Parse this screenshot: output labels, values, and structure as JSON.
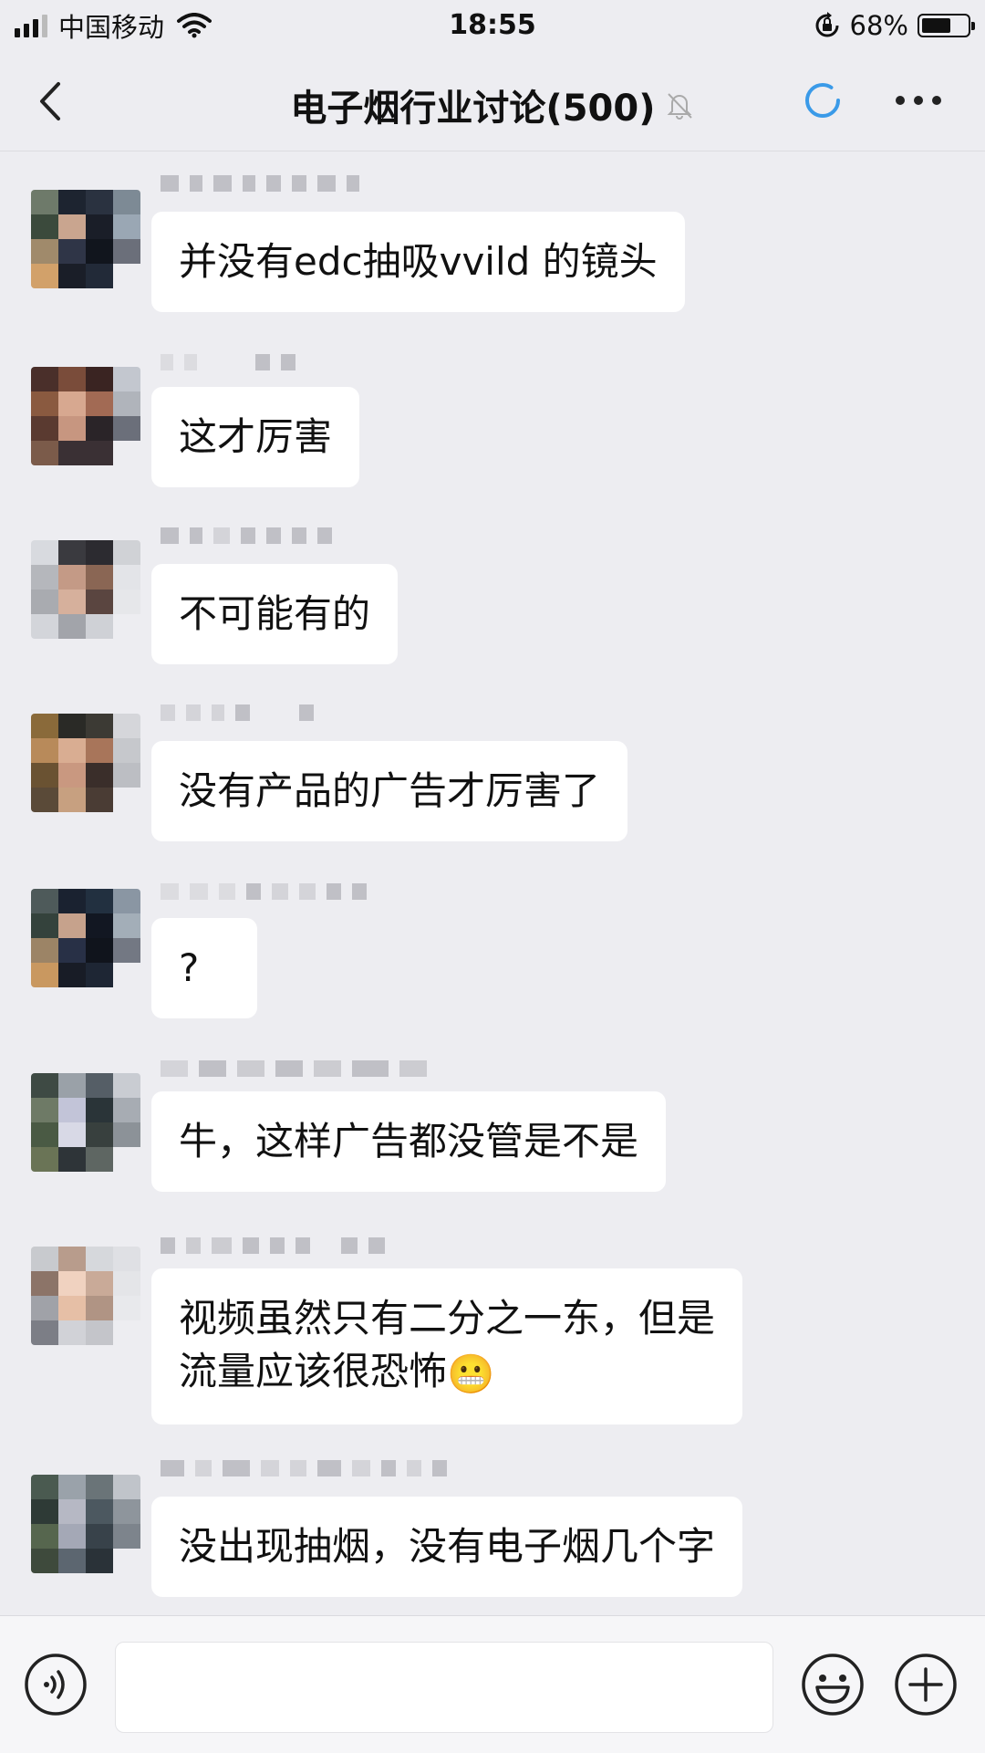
{
  "status_bar": {
    "carrier": "中国移动",
    "time": "18:55",
    "battery_percent": "68%",
    "battery_level": 0.68,
    "icons": [
      "signal-icon",
      "wifi-icon",
      "rotation-lock-icon",
      "battery-icon"
    ]
  },
  "nav": {
    "title": "电子烟行业讨论(500)",
    "icons": [
      "back-icon",
      "mute-bell-icon",
      "loading-spinner-icon",
      "more-icon"
    ]
  },
  "messages": [
    {
      "text": "并没有edc抽吸vvild 的镜头"
    },
    {
      "text": "这才厉害"
    },
    {
      "text": "不可能有的"
    },
    {
      "text": "没有产品的广告才厉害了"
    },
    {
      "text": "?"
    },
    {
      "text": "牛，这样广告都没管是不是"
    },
    {
      "text_line1": "视频虽然只有二分之一东，但是",
      "text_line2": "流量应该很恐怖",
      "emoji": "😬"
    },
    {
      "text": "没出现抽烟，没有电子烟几个字"
    }
  ],
  "input_bar": {
    "value": "",
    "icons": [
      "voice-icon",
      "emoji-icon",
      "plus-icon"
    ]
  },
  "colors": {
    "background": "#ededf1",
    "bubble": "#ffffff",
    "accent": "#3a9ae8"
  }
}
